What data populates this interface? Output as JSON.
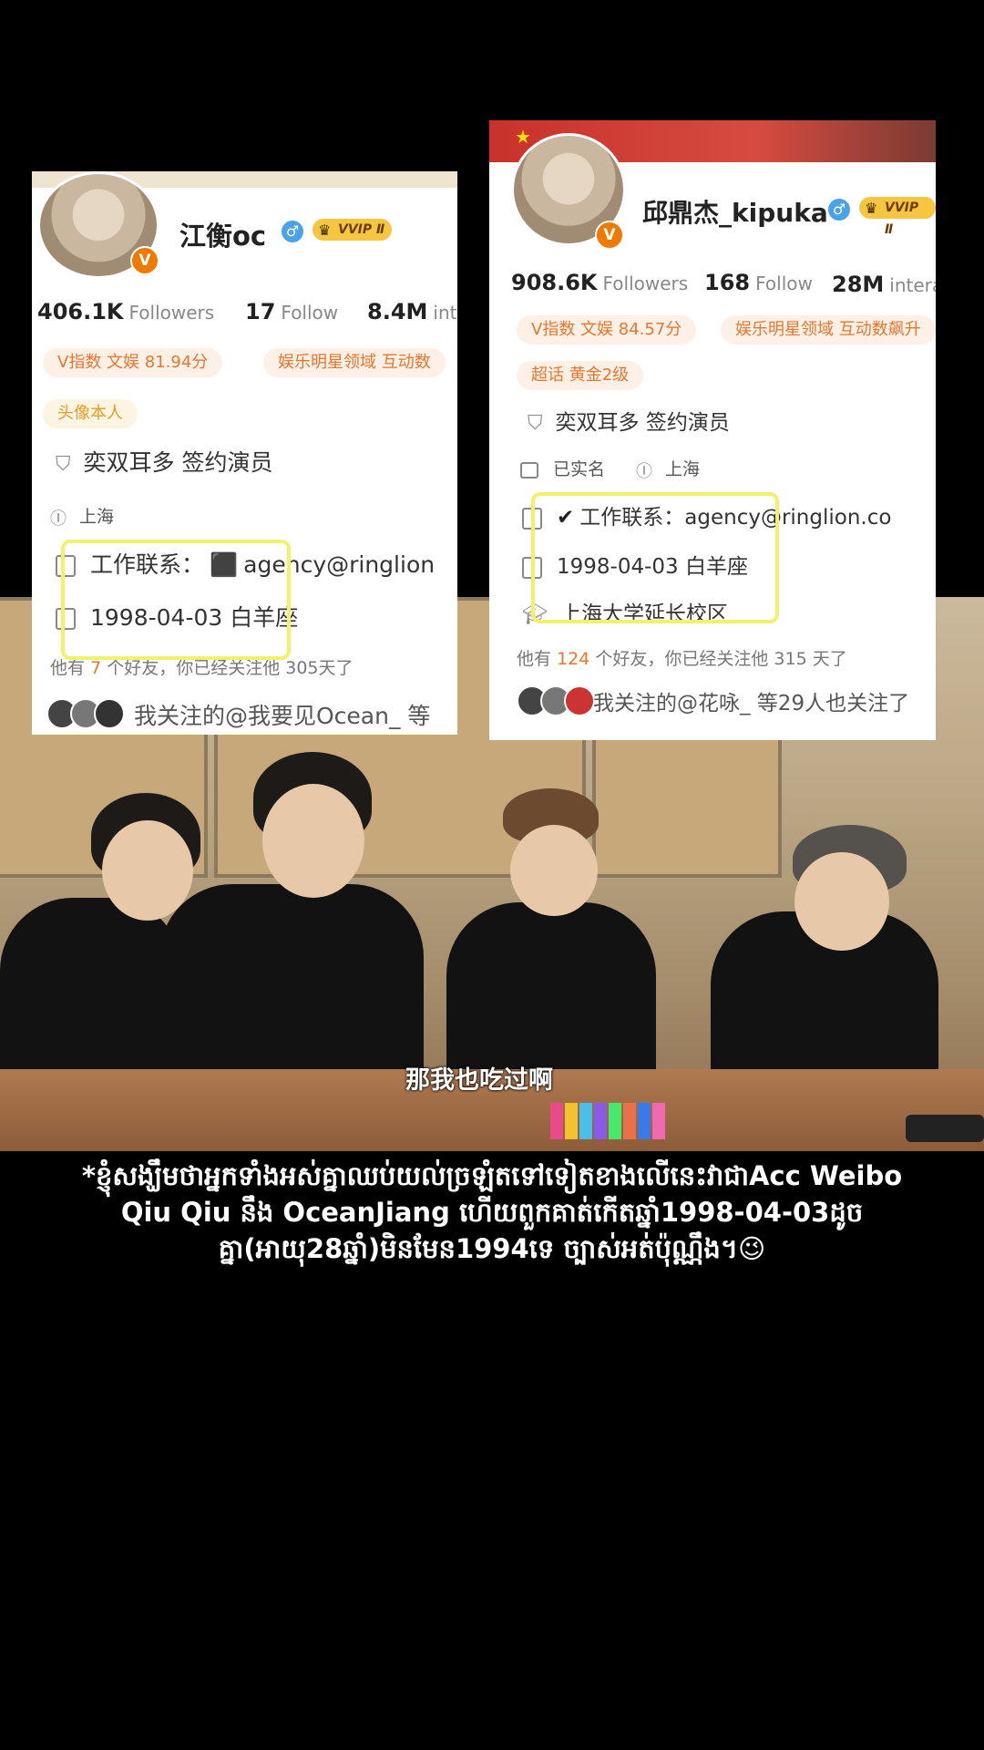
{
  "card_left": {
    "name": "江衡oc",
    "vvip": "VVIP Ⅱ",
    "vbadge": "V",
    "gender": "♂",
    "stats": [
      {
        "value": "406.1K",
        "label": "Followers"
      },
      {
        "value": "17",
        "label": "Follow"
      },
      {
        "value": "8.4M",
        "label": "int"
      }
    ],
    "tags": [
      "V指数 文娱 81.94分",
      "娱乐明星领域 互动数"
    ],
    "tag_yellow": "头像本人",
    "agency": "奕双耳多 签约演员",
    "ip": "上海",
    "work_contact": "工作联系：",
    "work_value": "agency@ringlion",
    "birthday": "1998-04-03 白羊座",
    "friends_prefix": "他有",
    "friends_count": "7",
    "friends_suffix": "个好友，你已经关注他 305天了",
    "mutual": "我关注的@我要见Ocean_ 等"
  },
  "card_right": {
    "name": "邱鼎杰_kipuka",
    "vvip": "VVIP Ⅱ",
    "vbadge": "V",
    "gender": "♂",
    "stats": [
      {
        "value": "908.6K",
        "label": "Followers"
      },
      {
        "value": "168",
        "label": "Follow"
      },
      {
        "value": "28M",
        "label": "intera"
      }
    ],
    "tags": [
      "V指数 文娱 84.57分",
      "娱乐明星领域 互动数飙升"
    ],
    "tag_second_row": "超话 黄金2级",
    "agency": "奕双耳多 签约演员",
    "verified": "已实名",
    "ip": "上海",
    "work_contact": "工作联系：",
    "work_value": "agency@ringlion.co",
    "birthday": "1998-04-03 白羊座",
    "school": "上海大学延长校区",
    "friends_prefix": "他有",
    "friends_count": "124",
    "friends_suffix": "个好友，你已经关注他 315 天了",
    "mutual": "我关注的@花咏_ 等29人也关注了"
  },
  "video": {
    "subtitle": "那我也吃过啊"
  },
  "caption": "*ខ្ញុំសង្ឃឹមថាអ្នកទាំងអស់គ្នាឈប់យល់ច្រឡំតទៅទៀតខាងលើនេះវាជាAcc Weibo Qiu Qiu នឹង OceanJiang ហើយពួកគាត់កើតឆ្នាំ1998-04-03ដូចគ្នា(អាយុ28ឆ្នាំ)មិនមែន1994ទេ ច្បាស់អត់ប៉ុណ្ណឹង។😉",
  "colors": {
    "highlight": "#f2f26a",
    "tag_orange": "#e9762e",
    "vvip_gold": "#f6c640",
    "weibo_orange": "#f07a00"
  }
}
